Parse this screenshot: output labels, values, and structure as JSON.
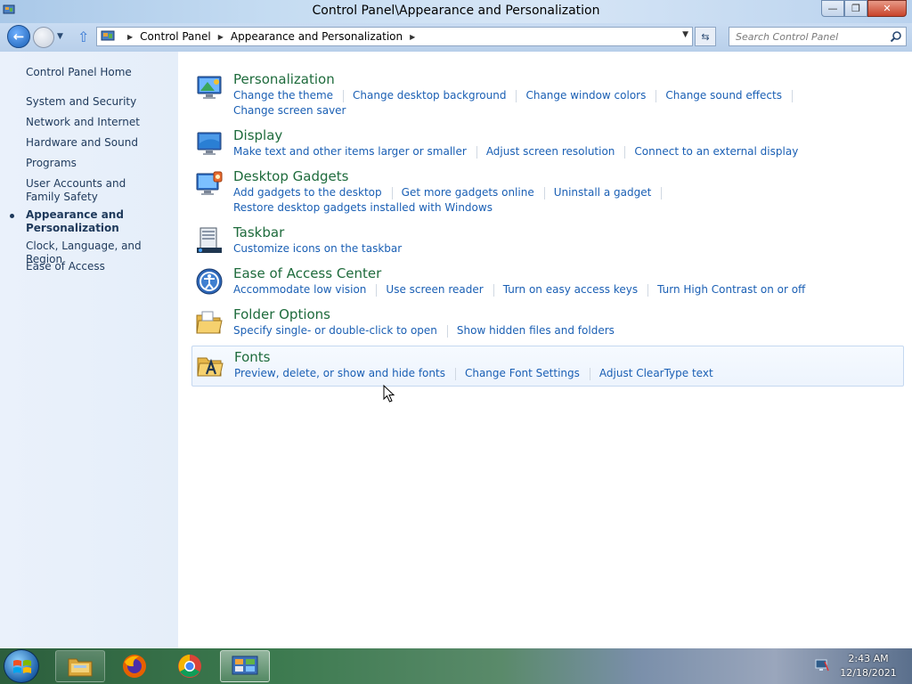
{
  "window": {
    "title": "Control Panel\\Appearance and Personalization",
    "minimize": "—",
    "maximize": "❐",
    "close": "✕"
  },
  "address": {
    "crumbs": [
      "Control Panel",
      "Appearance and Personalization"
    ],
    "search_placeholder": "Search Control Panel"
  },
  "left_pane": {
    "home": "Control Panel Home",
    "items": [
      {
        "label": "System and Security"
      },
      {
        "label": "Network and Internet"
      },
      {
        "label": "Hardware and Sound"
      },
      {
        "label": "Programs"
      },
      {
        "label": "User Accounts and Family Safety"
      },
      {
        "label": "Appearance and Personalization",
        "current": true
      },
      {
        "label": "Clock, Language, and Region"
      },
      {
        "label": "Ease of Access"
      }
    ]
  },
  "categories": [
    {
      "title": "Personalization",
      "icon": "personalization-icon",
      "tasks": [
        [
          "Change the theme",
          "Change desktop background",
          "Change window colors",
          "Change sound effects"
        ],
        [
          "Change screen saver"
        ]
      ]
    },
    {
      "title": "Display",
      "icon": "display-icon",
      "tasks": [
        [
          "Make text and other items larger or smaller",
          "Adjust screen resolution",
          "Connect to an external display"
        ]
      ]
    },
    {
      "title": "Desktop Gadgets",
      "icon": "gadgets-icon",
      "tasks": [
        [
          "Add gadgets to the desktop",
          "Get more gadgets online",
          "Uninstall a gadget"
        ],
        [
          "Restore desktop gadgets installed with Windows"
        ]
      ]
    },
    {
      "title": "Taskbar",
      "icon": "taskbar-icon",
      "tasks": [
        [
          "Customize icons on the taskbar"
        ]
      ]
    },
    {
      "title": "Ease of Access Center",
      "icon": "ease-of-access-icon",
      "tasks": [
        [
          "Accommodate low vision",
          "Use screen reader",
          "Turn on easy access keys",
          "Turn High Contrast on or off"
        ]
      ]
    },
    {
      "title": "Folder Options",
      "icon": "folder-options-icon",
      "tasks": [
        [
          "Specify single- or double-click to open",
          "Show hidden files and folders"
        ]
      ]
    },
    {
      "title": "Fonts",
      "icon": "fonts-icon",
      "hovered": true,
      "tasks": [
        [
          "Preview, delete, or show and hide fonts",
          "Change Font Settings",
          "Adjust ClearType text"
        ]
      ]
    }
  ],
  "taskbar": {
    "pinned": [
      "windows-explorer-icon",
      "firefox-icon",
      "chrome-icon",
      "control-panel-icon"
    ],
    "time": "2:43 AM",
    "date": "12/18/2021"
  },
  "colors": {
    "category_title": "#1e6b3c",
    "task_link": "#1a5fb4",
    "nav_text": "#1e395b"
  }
}
